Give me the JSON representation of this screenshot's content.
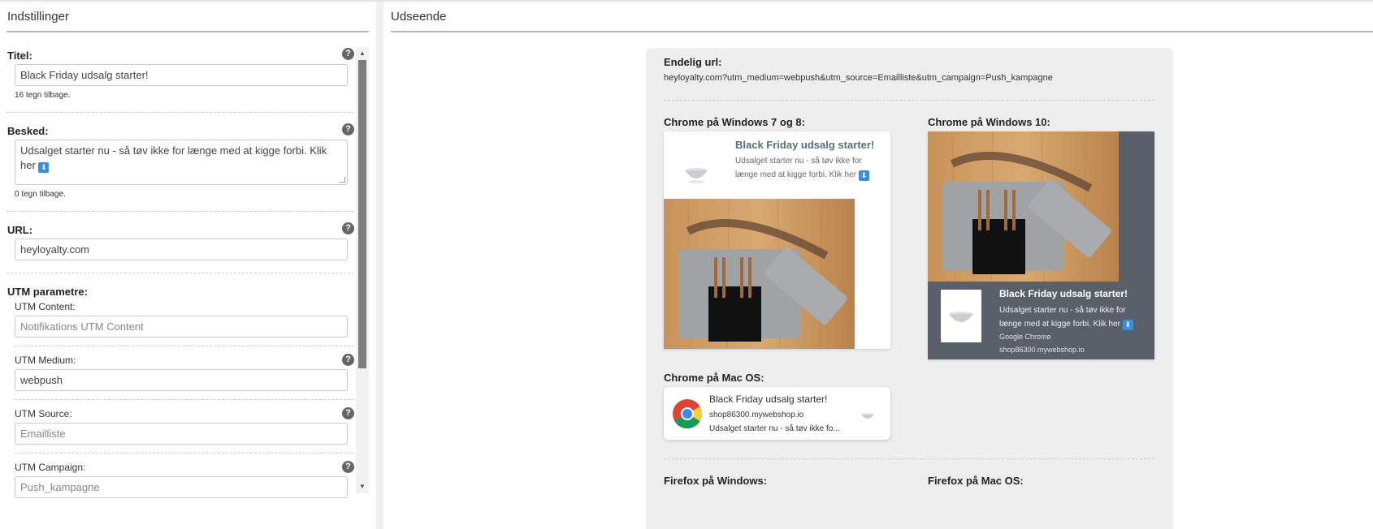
{
  "settings": {
    "title": "Indstillinger",
    "fields": {
      "titel": {
        "label": "Titel:",
        "value": "Black Friday udsalg starter!",
        "hint": "16 tegn tilbage."
      },
      "besked": {
        "label": "Besked:",
        "value": "Udsalget starter nu - så tøv ikke for længe med at kigge forbi. Klik her",
        "hint": "0 tegn tilbage."
      },
      "url": {
        "label": "URL:",
        "value": "heyloyalty.com"
      },
      "utm": {
        "label": "UTM parametre:",
        "content": {
          "label": "UTM Content:",
          "placeholder": "Notifikations UTM Content"
        },
        "medium": {
          "label": "UTM Medium:",
          "value": "webpush"
        },
        "source": {
          "label": "UTM Source:",
          "placeholder": "Emailliste"
        },
        "campaign": {
          "label": "UTM Campaign:",
          "placeholder": "Push_kampagne"
        }
      }
    }
  },
  "appearance": {
    "title": "Udseende",
    "final_url_label": "Endelig url:",
    "final_url": "heyloyalty.com?utm_medium=webpush&utm_source=Emailliste&utm_campaign=Push_kampagne",
    "windows78": {
      "label": "Chrome på Windows 7 og 8:",
      "title": "Black Friday udsalg starter!",
      "body": "Udsalget starter nu - så tøv ikke for længe med at kigge forbi. Klik her"
    },
    "windows10": {
      "label": "Chrome på Windows 10:",
      "title": "Black Friday udsalg starter!",
      "body": "Udsalget starter nu - så tøv ikke for længe med at kigge forbi. Klik her",
      "app": "Google Chrome",
      "host": "shop86300.mywebshop.io"
    },
    "mac": {
      "label": "Chrome på Mac OS:",
      "title": "Black Friday udsalg starter!",
      "host": "shop86300.mywebshop.io",
      "body": "Udsalget starter nu - så tøv ikke fo..."
    },
    "firefox_windows": {
      "label": "Firefox på Windows:"
    },
    "firefox_mac": {
      "label": "Firefox på Mac OS:"
    }
  },
  "icons": {
    "help": "question-circle-icon",
    "emoji": "down-arrow-emoji-icon",
    "chrome": "chrome-logo-icon"
  },
  "colors": {
    "win10_bg": "#5a6069",
    "preview_bg": "#eeeeee",
    "w7_title": "#5b6e7c",
    "emoji_blue": "#3b8fd9"
  }
}
